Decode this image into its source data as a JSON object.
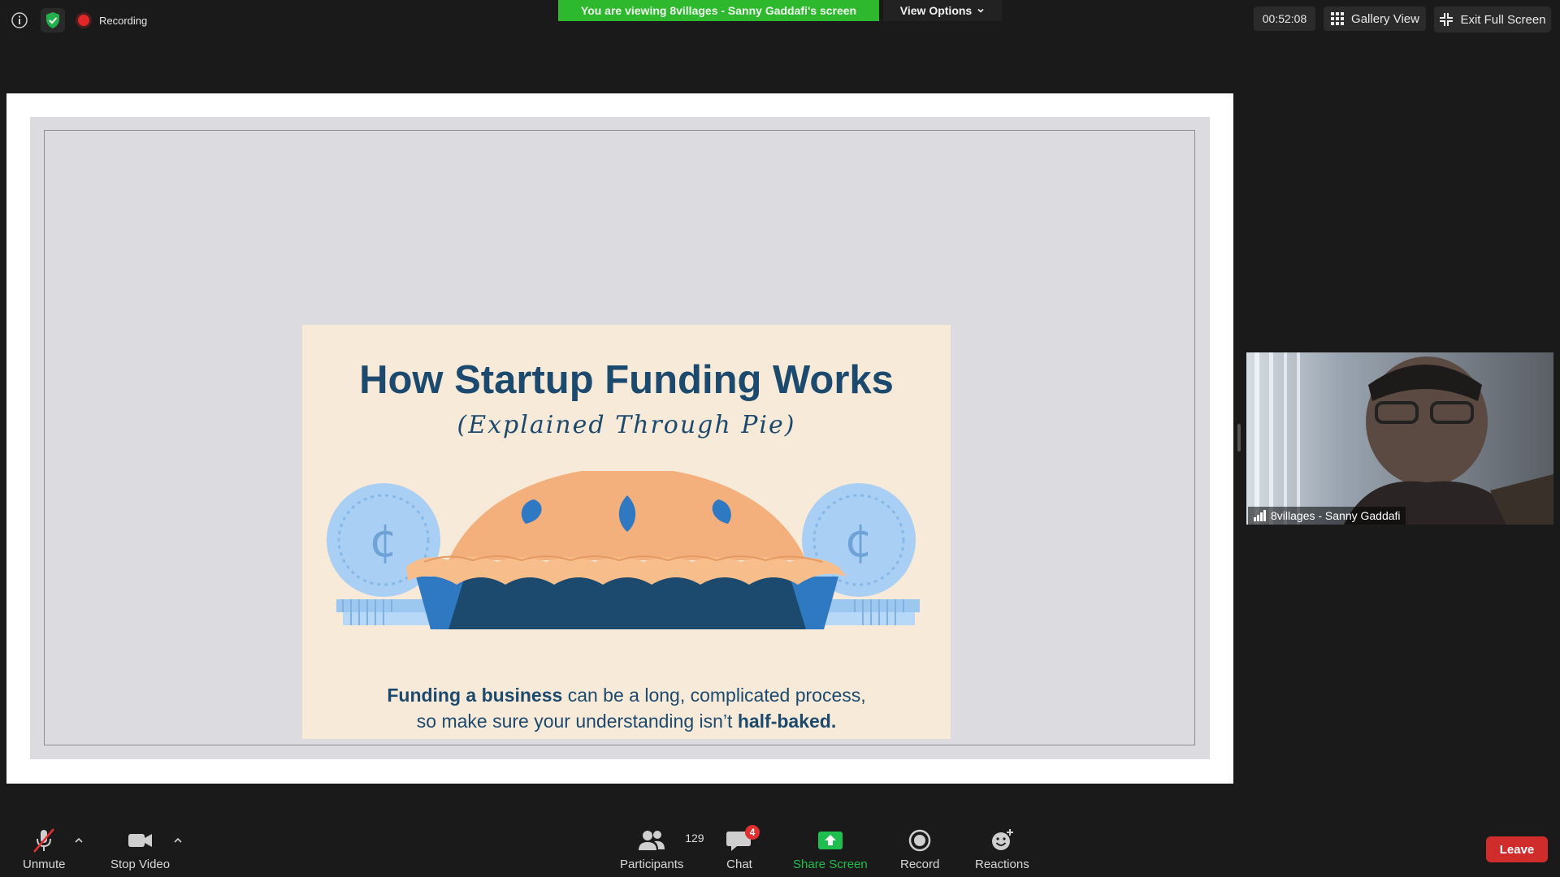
{
  "top_bar": {
    "recording_label": "Recording",
    "viewing_banner": "You are viewing 8villages - Sanny Gaddafi's screen",
    "view_options_label": "View Options",
    "timer": "00:52:08",
    "gallery_view_label": "Gallery View",
    "exit_full_screen_label": "Exit Full Screen",
    "icons": [
      "info-icon",
      "shield-check-icon",
      "recording-icon",
      "chevron-down-icon",
      "grid-icon",
      "exit-fullscreen-icon"
    ]
  },
  "shared_slide": {
    "title": "How Startup Funding Works",
    "subtitle": "(Explained Through Pie)",
    "caption_bold_1": "Funding a business",
    "caption_normal_1": " can be a long, complicated process,",
    "caption_normal_2": "so make sure your understanding isn’t ",
    "caption_bold_2": "half-baked."
  },
  "video_tile": {
    "participant_name": "8villages - Sanny Gaddafi"
  },
  "toolbar": {
    "unmute_label": "Unmute",
    "stop_video_label": "Stop Video",
    "participants_label": "Participants",
    "participants_count": "129",
    "chat_label": "Chat",
    "chat_badge": "4",
    "share_screen_label": "Share Screen",
    "record_label": "Record",
    "reactions_label": "Reactions",
    "leave_label": "Leave"
  },
  "colors": {
    "banner_green": "#2eb82e",
    "share_green": "#1fbf4f",
    "leave_red": "#d12c2c",
    "slide_navy": "#1c4a6e",
    "slide_cream": "#f8ead9",
    "pie_crust": "#f4b07c",
    "coin_blue": "#a9cff5"
  }
}
